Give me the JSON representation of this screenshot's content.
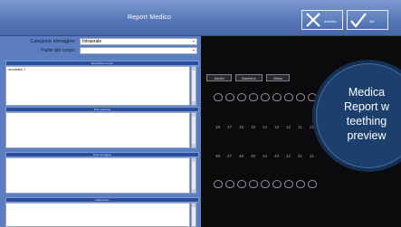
{
  "window": {
    "title": "Report Medico",
    "cancel_label": "Annulla",
    "ok_label": "Ok"
  },
  "form": {
    "category_label": "Categoria immagine:",
    "category_value": "Intraorale",
    "body_part_label": "Parte del corpo:",
    "body_part_value": ""
  },
  "sections": [
    {
      "title": "Descrizione dente",
      "text": "annotation 1"
    },
    {
      "title": "Note paziente",
      "text": ""
    },
    {
      "title": "Note immagine",
      "text": ""
    },
    {
      "title": "Valutazione",
      "text": ""
    }
  ],
  "chart": {
    "tabs": [
      "Adulto",
      "Bambino",
      "Mista"
    ],
    "upper_numbers": [
      "18",
      "17",
      "16",
      "15",
      "14",
      "13",
      "12",
      "11",
      "21"
    ],
    "lower_numbers": [
      "48",
      "47",
      "46",
      "45",
      "44",
      "43",
      "42",
      "41",
      "31"
    ]
  },
  "overlay": {
    "line1": "Medica",
    "line2": "Report w",
    "line3": "teething",
    "line4": "preview"
  },
  "colors": {
    "titlebar": "#5877b9",
    "left_panel": "#5c7ec0",
    "chart_background": "#0b0b0d",
    "overlay_circle": "#1d3f6e"
  },
  "icons": {
    "cancel": "close-icon",
    "ok": "checkmark-icon",
    "dropdown": "chevron-down-icon"
  }
}
